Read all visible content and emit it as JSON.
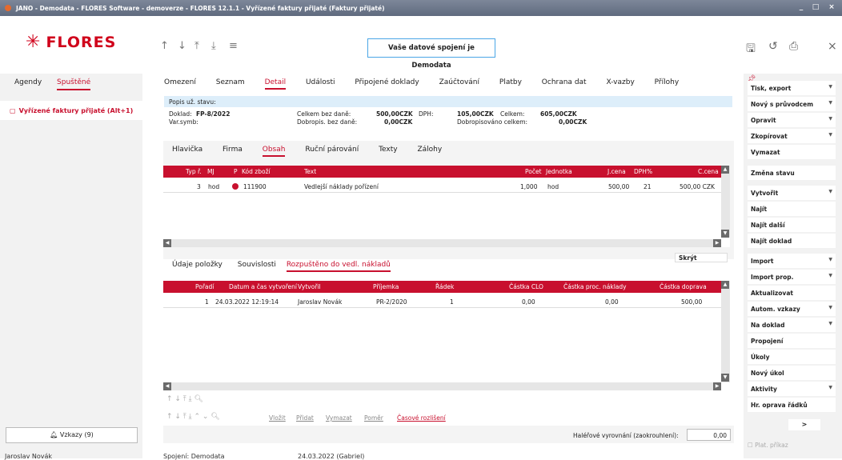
{
  "title": "JANO - Demodata - FLORES Software - demoverze - FLORES 12.1.1 - Vyřízené faktury přijaté (Faktury přijaté)",
  "window_controls": [
    "_",
    "□",
    "×"
  ],
  "logo": "FLORES",
  "nav_icons": [
    "arrow-up-icon",
    "arrow-down-icon",
    "arrow-top-icon",
    "arrow-bottom-icon",
    "menu-icon"
  ],
  "banner": "Vaše datové spojení je Demodata",
  "toolbar_icons": [
    "save-icon",
    "undo-icon",
    "print-icon",
    "close-icon"
  ],
  "left": {
    "tabs": [
      "Agendy",
      "Spuštěné"
    ],
    "active_item": "Vyřízené faktury přijaté (Alt+1)",
    "vzkazy": "Vzkazy (9)",
    "user": "Jaroslav Novák"
  },
  "main_tabs": [
    "Omezení",
    "Seznam",
    "Detail",
    "Události",
    "Připojené doklady",
    "Zaúčtování",
    "Platby",
    "Ochrana dat",
    "X-vazby",
    "Přílohy"
  ],
  "info": {
    "popis": "Popis už. stavu:",
    "doklad_label": "Doklad:",
    "doklad_value": "FP-8/2022",
    "varsymb": "Var.symb:",
    "celkem_bez_dane_label": "Celkem bez daně:",
    "celkem_bez_dane_value": "500,00CZK",
    "dph_label": "DPH:",
    "dph_value": "105,00CZK",
    "celkem_label": "Celkem:",
    "celkem_value": "605,00CZK",
    "dobropis_label": "Dobropis. bez daně:",
    "dobropis_value": "0,00CZK",
    "dobropisovano_label": "Dobropisováno celkem:",
    "dobropisovano_value": "0,00CZK"
  },
  "sub_tabs": [
    "Hlavička",
    "Firma",
    "Obsah",
    "Ruční párování",
    "Texty",
    "Zálohy"
  ],
  "grid1": {
    "headers": [
      "Typ ř.",
      "MJ",
      "P",
      "Kód zboží",
      "Text",
      "Počet",
      "Jednotka",
      "J.cena",
      "DPH%",
      "C.cena"
    ],
    "row": [
      "3",
      "hod",
      "111900",
      "Vedlejší náklady pořízení",
      "1,000",
      "hod",
      "500,00",
      "21",
      "500,00 CZK"
    ]
  },
  "lower_tabs": [
    "Údaje položky",
    "Souvislosti",
    "Rozpuštěno do vedl. nákladů"
  ],
  "skryt": "Skrýt",
  "grid2": {
    "headers": [
      "Pořadí",
      "Datum a čas vytvoření",
      "Vytvořil",
      "Příjemka",
      "Řádek",
      "Částka CLO",
      "Částka proc. náklady",
      "Částka doprava"
    ],
    "row": [
      "1",
      "24.03.2022 12:19:14",
      "Jaroslav Novák",
      "PR-2/2020",
      "1",
      "0,00",
      "0,00",
      "500,00"
    ]
  },
  "action_links": [
    "Vložit",
    "Přidat",
    "Vymazat",
    "Poměr",
    "Časové rozlišení"
  ],
  "rounding_label": "Haléřové vyrovnání (zaokrouhlení):",
  "rounding_value": "0,00",
  "status": {
    "spojeni": "Spojení: Demodata",
    "date": "24.03.2022 (Gabriel)"
  },
  "right_buttons": [
    {
      "label": "Tisk, export",
      "dropdown": true
    },
    {
      "label": "Nový s průvodcem",
      "dropdown": true
    },
    {
      "label": "Opravit",
      "dropdown": true
    },
    {
      "label": "Zkopírovat",
      "dropdown": true
    },
    {
      "label": "Vymazat",
      "dropdown": false
    },
    {
      "label": "Změna stavu",
      "dropdown": false
    },
    {
      "label": "Vytvořit",
      "dropdown": true
    },
    {
      "label": "Najít",
      "dropdown": false
    },
    {
      "label": "Najít další",
      "dropdown": false
    },
    {
      "label": "Najít doklad",
      "dropdown": false
    },
    {
      "label": "Import",
      "dropdown": true
    },
    {
      "label": "Import prop.",
      "dropdown": true
    },
    {
      "label": "Aktualizovat",
      "dropdown": false
    },
    {
      "label": "Autom. vzkazy",
      "dropdown": true
    },
    {
      "label": "Na doklad",
      "dropdown": true
    },
    {
      "label": "Propojení",
      "dropdown": false
    },
    {
      "label": "Úkoly",
      "dropdown": false
    },
    {
      "label": "Nový úkol",
      "dropdown": false
    },
    {
      "label": "Aktivity",
      "dropdown": true
    },
    {
      "label": "Hr. oprava řádků",
      "dropdown": false
    }
  ],
  "right_more": ">",
  "plat_prikaz": "Plat. příkaz",
  "colors": {
    "accent": "#c8102e",
    "titlebar": "#6b7588"
  }
}
